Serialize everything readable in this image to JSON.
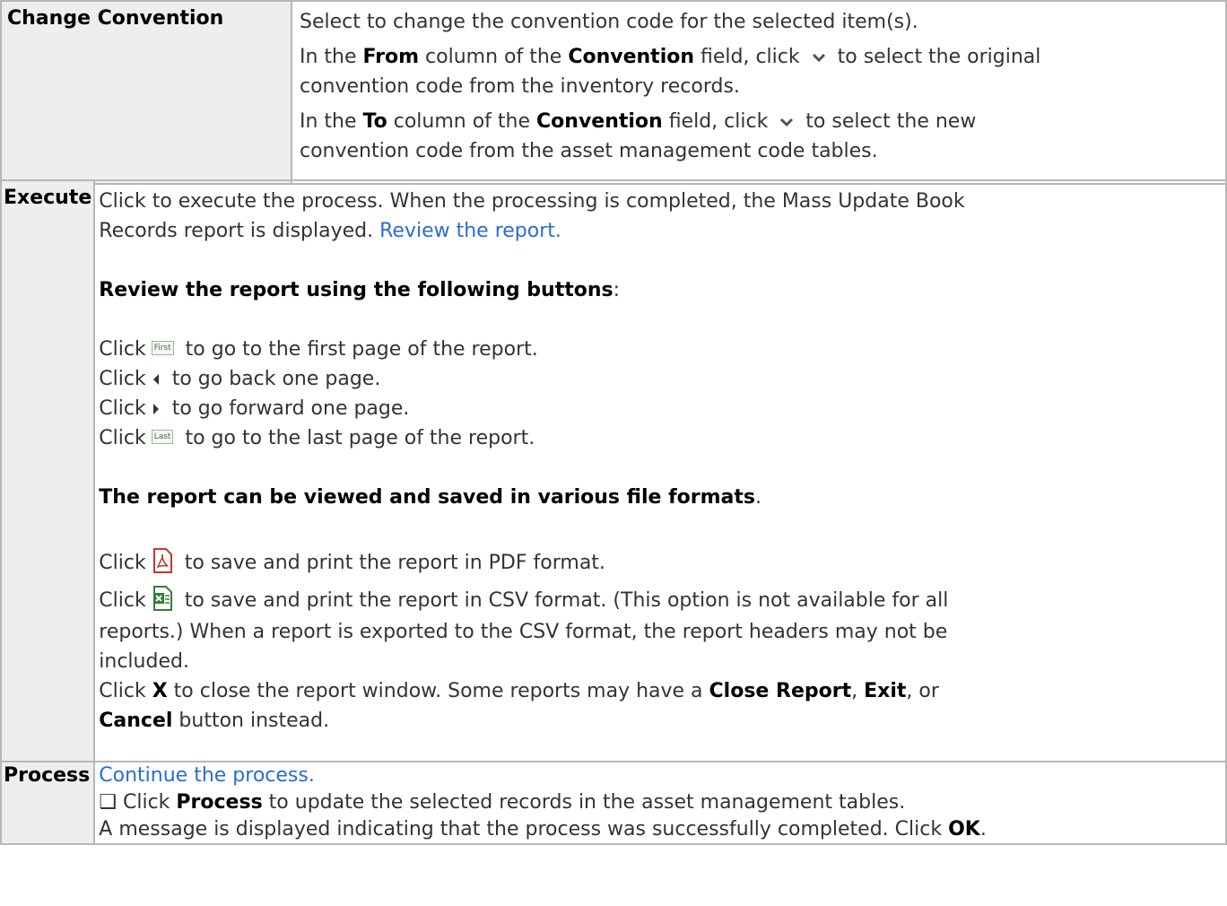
{
  "sections": {
    "change_convention": {
      "heading": "Change Convention",
      "line1": "Select to change the convention code for the selected item(s).",
      "from": {
        "pre": "In the ",
        "b1": "From",
        "mid": " column of the ",
        "b2": "Convention",
        "post_click": " field, click ",
        "rest_a": " to select the original",
        "rest_b": "convention code from the inventory records."
      },
      "to": {
        "pre": "In the ",
        "b1": "To",
        "mid": " column of the ",
        "b2": "Convention",
        "post_click": " field, click ",
        "rest_a": " to select the new",
        "rest_b": "convention code from the asset management code tables."
      }
    },
    "execute": {
      "heading": "Execute",
      "intro_a": "Click to execute the process. When the processing is completed, the Mass Update Book",
      "intro_b": "Records report is displayed. ",
      "review_link": "Review the report.",
      "buttons_heading": "Review the report using the following buttons",
      "colon": ":",
      "click_word": "Click",
      "nav": [
        {
          "icon": "first-page-button-icon",
          "label": "First",
          "text": " to go to the first page of the report."
        },
        {
          "icon": "previous-page-icon",
          "text": " to go back one page."
        },
        {
          "icon": "next-page-icon",
          "text": " to go forward one page."
        },
        {
          "icon": "last-page-button-icon",
          "label": "Last",
          "text": " to go to the last page of the report."
        }
      ],
      "formats_heading": "The report can be viewed and saved in various file formats",
      "period": ".",
      "pdf_text": " to save and print the report in PDF format.",
      "csv_a": " to save and print the report in CSV format. (This option is not available for all",
      "csv_b": "reports.) When a report is exported to the CSV format, the report headers may not be",
      "csv_c": "included.",
      "close": {
        "pre": "Click ",
        "x": "X",
        "a": " to close the report window. Some reports may have a ",
        "b1": "Close Report",
        "comma1": ", ",
        "b2": "Exit",
        "or": ", or",
        "b3": "Cancel",
        "end": " button instead."
      }
    },
    "process": {
      "heading": "Process",
      "link": "Continue the process.",
      "line2_pre": "❑ Click ",
      "line2_b": "Process",
      "line2_post": " to update the selected records in the asset management tables.",
      "line3_pre": "A message is displayed indicating that the process was successfully completed. Click ",
      "line3_b": "OK",
      "line3_post": "."
    }
  },
  "colors": {
    "link": "#2a6bd6",
    "header_bg": "#eeeeee",
    "border": "#b8b8b8"
  }
}
